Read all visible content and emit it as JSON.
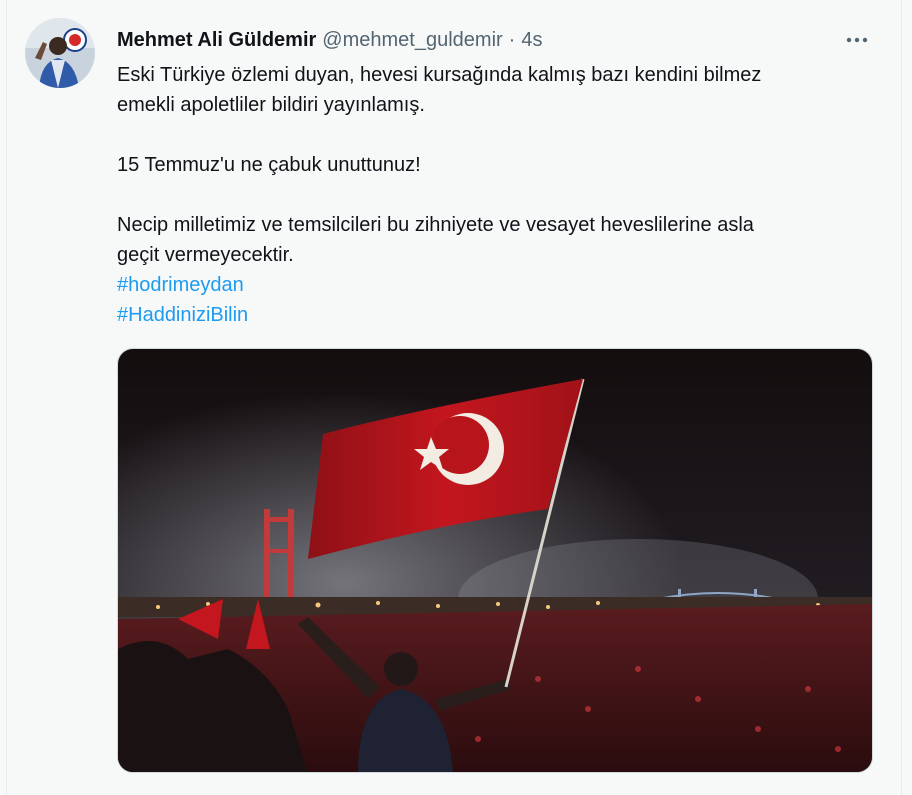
{
  "tweet": {
    "author_name": "Mehmet Ali Güldemir",
    "handle": "@mehmet_guldemir",
    "separator": "·",
    "time": "4s",
    "more_icon": "more-horizontal-icon",
    "text_lines": [
      "Eski Türkiye özlemi duyan, hevesi kursağında kalmış bazı kendini bilmez",
      "emekli apoletliler bildiri yayınlamış.",
      "15 Temmuz'u ne çabuk unuttunuz!",
      "Necip milletimiz ve temsilcileri bu zihniyete ve vesayet heveslilerine asla",
      "geçit vermeyecektir."
    ],
    "hashtags": [
      "#hodrimeydan",
      "#HaddiniziBilin"
    ]
  },
  "colors": {
    "name": "#0f1419",
    "secondary": "#536471",
    "link": "#1d9bf0",
    "flag_red": "#e30a17",
    "background": "#f7f9f9"
  }
}
